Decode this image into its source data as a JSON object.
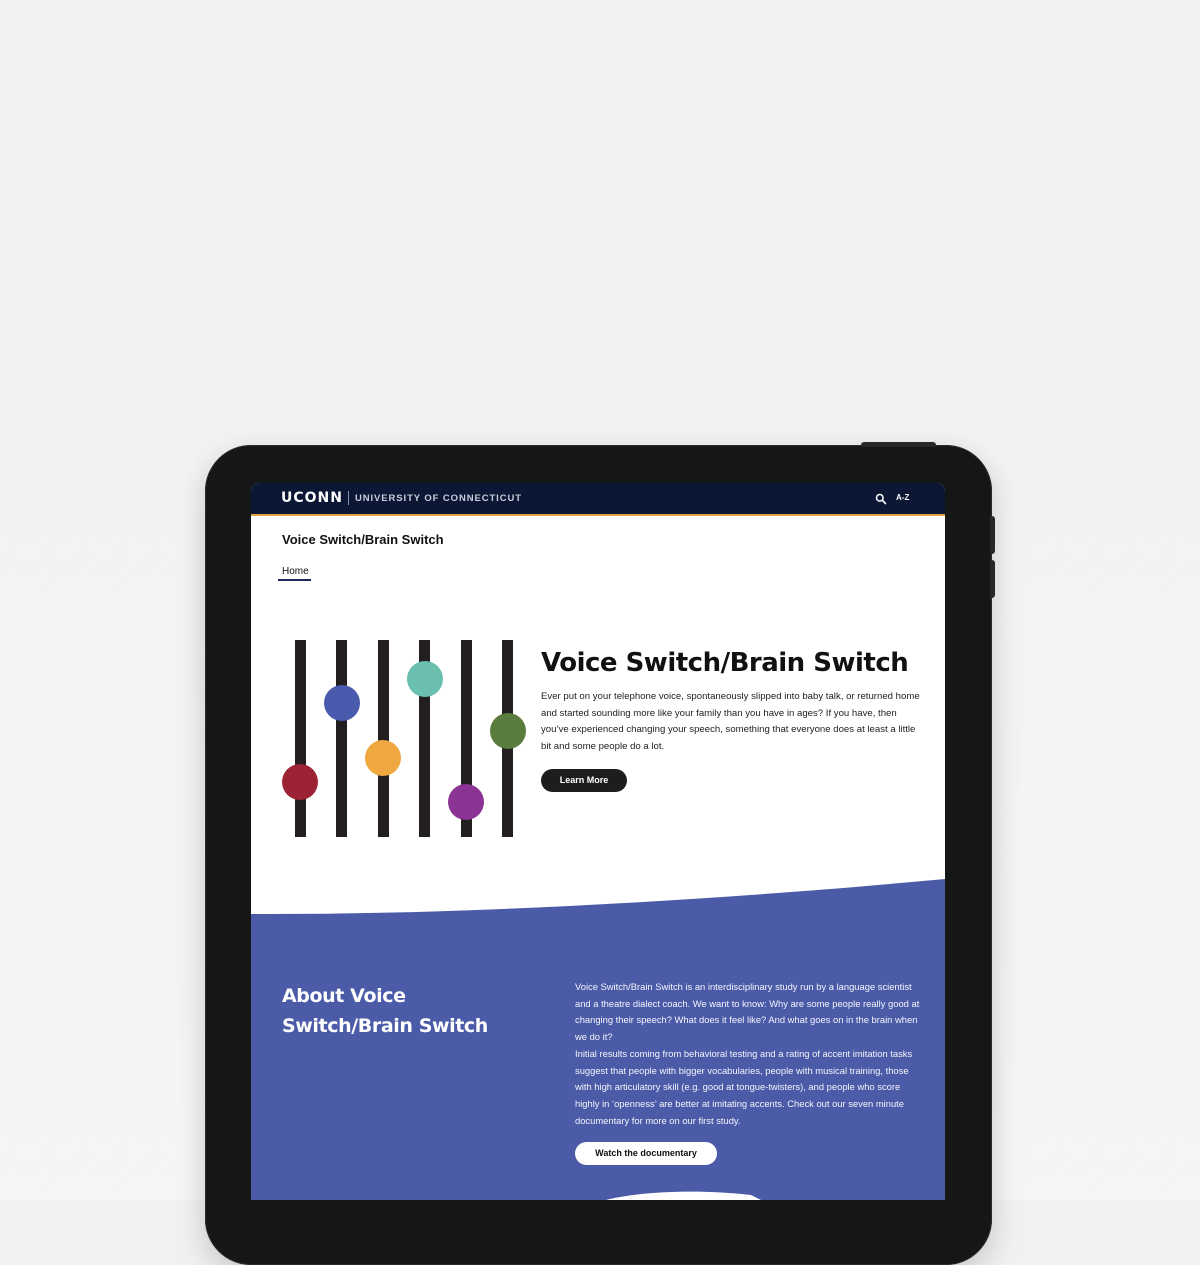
{
  "header": {
    "logo": "UCONN",
    "university": "UNIVERSITY OF CONNECTICUT",
    "search_icon": "search-icon",
    "az_label": "A-Z",
    "accent_color": "#e1a33c",
    "background_color": "#0b1734"
  },
  "site": {
    "title": "Voice Switch/Brain Switch"
  },
  "nav": {
    "items": [
      {
        "label": "Home",
        "active": true
      }
    ]
  },
  "hero": {
    "title": "Voice Switch/Brain Switch",
    "text": "Ever put on your telephone voice, spontaneously slipped into baby talk, or returned home and started sounding more like your family than you have in ages?  If you have, then you’ve experienced changing your speech, something that everyone does at least a little bit and some people do a lot.",
    "button": "Learn More",
    "illustration": {
      "knob_colors": [
        "#9b2335",
        "#4a5aac",
        "#efa83f",
        "#6abfae",
        "#8b3495",
        "#5a7d3d"
      ],
      "knob_levels": [
        0.28,
        0.68,
        0.4,
        0.8,
        0.18,
        0.54
      ]
    }
  },
  "about": {
    "title": "About Voice Switch/Brain Switch",
    "paragraph1": "Voice Switch/Brain Switch is an interdisciplinary study run by a language scientist and a theatre dialect coach.  We want to know: Why are some people really good at changing their speech?  What does it feel like?  And what goes on in the brain when we do it?",
    "paragraph2": "Initial results coming from behavioral testing and a rating of accent imitation tasks suggest that people with bigger vocabularies, people with musical training, those with high articulatory skill (e.g. good at tongue-twisters), and people who score highly in ‘openness’ are better at imitating accents.  Check out our seven minute documentary for more on our first study.",
    "button": "Watch the documentary",
    "background_color": "#4b5ba8"
  }
}
